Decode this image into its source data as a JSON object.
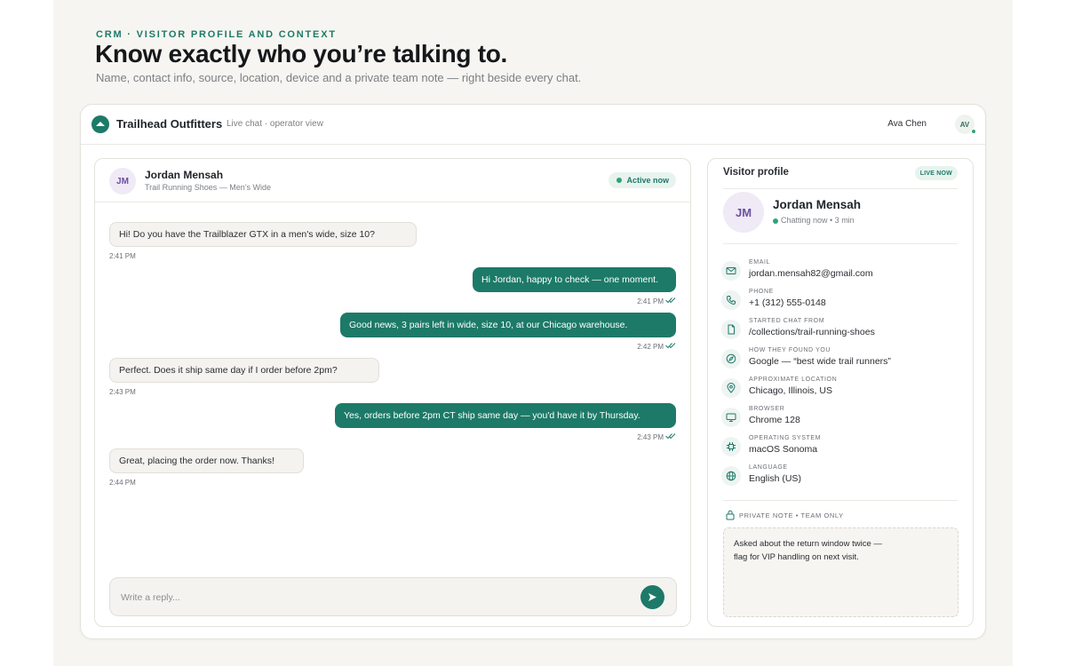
{
  "page": {
    "eyebrow": "CRM · VISITOR PROFILE AND CONTEXT",
    "headline": "Know exactly who you’re talking to.",
    "subhead": "Name, contact info, source, location, device and a private team note — right beside every chat."
  },
  "topbar": {
    "brand": "Trailhead Outfitters",
    "subtitle": "Live chat · operator view",
    "operator_name": "Ava Chen",
    "operator_initials": "AV"
  },
  "chat": {
    "visitor_initials": "JM",
    "visitor_name": "Jordan Mensah",
    "visitor_context": "Trail Running Shoes — Men’s Wide",
    "status": "Active now",
    "messages": [
      {
        "direction": "in",
        "text": "Hi! Do you have the Trailblazer GTX in a men's wide, size 10?",
        "time": "2:41 PM"
      },
      {
        "direction": "out",
        "text": "Hi Jordan, happy to check — one moment.",
        "time": "2:41 PM"
      },
      {
        "direction": "out",
        "text": "Good news, 3 pairs left in wide, size 10, at our Chicago warehouse.",
        "time": "2:42 PM"
      },
      {
        "direction": "in",
        "text": "Perfect. Does it ship same day if I order before 2pm?",
        "time": "2:43 PM"
      },
      {
        "direction": "out",
        "text": "Yes, orders before 2pm CT ship same day — you'd have it by Thursday.",
        "time": "2:43 PM"
      },
      {
        "direction": "in",
        "text": "Great, placing the order now. Thanks!",
        "time": "2:44 PM"
      }
    ],
    "reply_placeholder": "Write a reply..."
  },
  "profile": {
    "title": "Visitor profile",
    "live_badge": "LIVE NOW",
    "initials": "JM",
    "name": "Jordan Mensah",
    "status": "Chatting now • 3 min",
    "fields": [
      {
        "icon": "email-icon",
        "label": "EMAIL",
        "value": "jordan.mensah82@gmail.com"
      },
      {
        "icon": "phone-icon",
        "label": "PHONE",
        "value": "+1 (312) 555-0148"
      },
      {
        "icon": "page-icon",
        "label": "STARTED CHAT FROM",
        "value": "/collections/trail-running-shoes"
      },
      {
        "icon": "compass-icon",
        "label": "HOW THEY FOUND YOU",
        "value": "Google — “best wide trail runners”"
      },
      {
        "icon": "location-pin-icon",
        "label": "APPROXIMATE LOCATION",
        "value": "Chicago, Illinois, US"
      },
      {
        "icon": "monitor-icon",
        "label": "BROWSER",
        "value": "Chrome 128"
      },
      {
        "icon": "chip-icon",
        "label": "OPERATING SYSTEM",
        "value": "macOS Sonoma"
      },
      {
        "icon": "globe-icon",
        "label": "LANGUAGE",
        "value": "English (US)"
      }
    ],
    "note_label": "PRIVATE NOTE • TEAM ONLY",
    "note_text": "Asked about the return window twice — flag for VIP handling on next visit."
  },
  "colors": {
    "accent": "#1d7a68",
    "accent_soft": "#e8f3ee",
    "online": "#2fa37a",
    "avatar_bg": "#efeaf6",
    "avatar_text": "#6d4fa0"
  }
}
